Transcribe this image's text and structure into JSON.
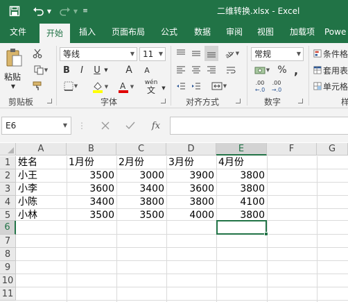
{
  "window": {
    "title": "二维转换.xlsx  -  Excel",
    "accent_color": "#217346"
  },
  "quick_access": {
    "icons": [
      "save-icon",
      "undo-icon",
      "redo-icon",
      "customize-qat-icon"
    ]
  },
  "ribbon_tabs": [
    {
      "label": "文件",
      "active": false
    },
    {
      "label": "开始",
      "active": true
    },
    {
      "label": "插入",
      "active": false
    },
    {
      "label": "页面布局",
      "active": false
    },
    {
      "label": "公式",
      "active": false
    },
    {
      "label": "数据",
      "active": false
    },
    {
      "label": "审阅",
      "active": false
    },
    {
      "label": "视图",
      "active": false
    },
    {
      "label": "加载项",
      "active": false
    },
    {
      "label": "Powe",
      "active": false
    }
  ],
  "ribbon": {
    "clipboard": {
      "label": "剪贴板",
      "paste_label": "粘贴"
    },
    "font": {
      "label": "字体",
      "font_name": "等线",
      "font_size": "11",
      "bold": "B",
      "italic": "I",
      "underline": "U",
      "grow": "A",
      "shrink": "A",
      "phonetic": "wén",
      "phonetic_char": "文"
    },
    "alignment": {
      "label": "对齐方式"
    },
    "number": {
      "label": "数字",
      "format": "常规",
      "percent": "%",
      "comma": ",",
      "inc_decimal": ".00",
      "dec_decimal": ".00"
    },
    "styles": {
      "items": [
        "条件格",
        "套用表",
        "单元格"
      ],
      "label": "样"
    }
  },
  "formula_bar": {
    "name_box": "E6",
    "cancel_icon": "close-icon",
    "enter_icon": "check-icon",
    "function_label": "fx",
    "formula": ""
  },
  "sheet": {
    "columns": [
      "A",
      "B",
      "C",
      "D",
      "E",
      "F",
      "G"
    ],
    "rows": [
      "1",
      "2",
      "3",
      "4",
      "5",
      "6",
      "7",
      "8",
      "9",
      "10",
      "11"
    ],
    "selected_cell": "E6",
    "data": [
      [
        "姓名",
        "1月份",
        "2月份",
        "3月份",
        "4月份"
      ],
      [
        "小王",
        "3500",
        "3000",
        "3900",
        "3800"
      ],
      [
        "小李",
        "3600",
        "3400",
        "3600",
        "3800"
      ],
      [
        "小陈",
        "3400",
        "3800",
        "3800",
        "4100"
      ],
      [
        "小林",
        "3500",
        "3500",
        "4000",
        "3800"
      ]
    ]
  }
}
